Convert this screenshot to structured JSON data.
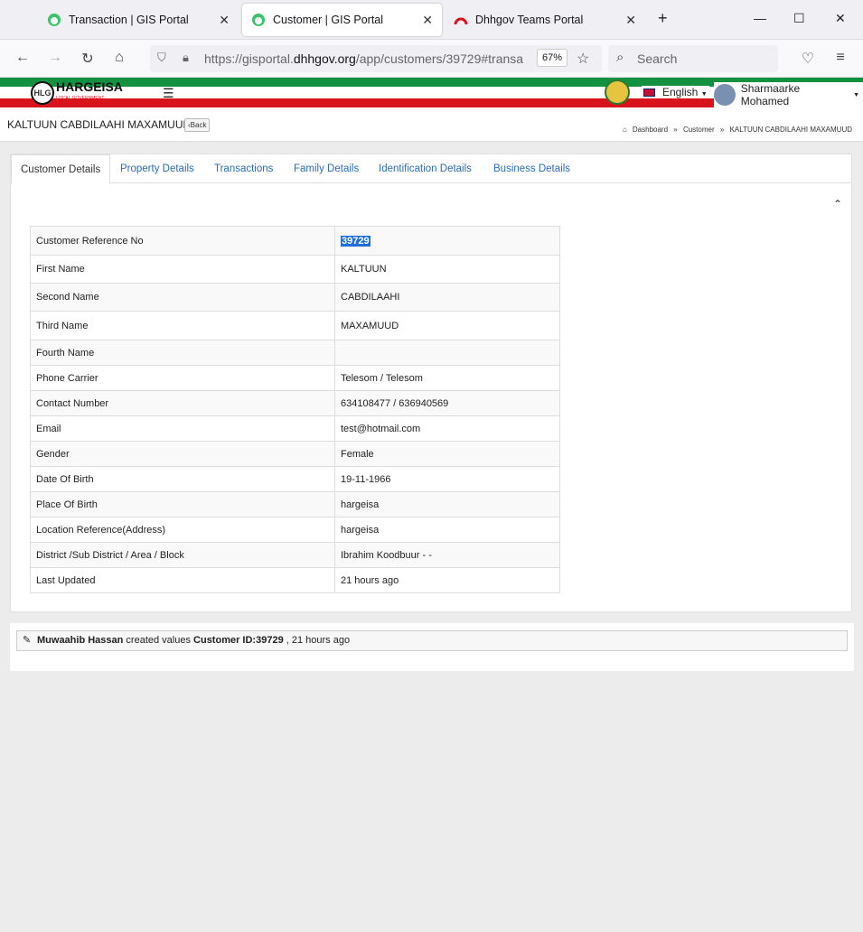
{
  "browser": {
    "tabs": [
      {
        "title": "Transaction | GIS Portal",
        "active": false
      },
      {
        "title": "Customer | GIS Portal",
        "active": true
      },
      {
        "title": "Dhhgov Teams Portal",
        "active": false
      }
    ],
    "url_prefix": "https://gisportal.",
    "url_domain": "dhhgov.org",
    "url_path": "/app/customers/39729#transa",
    "zoom": "67%",
    "search_placeholder": "Search"
  },
  "header": {
    "brand": "HARGEISA",
    "brand_sub": "LOCAL GOVERNMENT",
    "logo_text": "HLG",
    "language": "English",
    "user": "Sharmaarke Mohamed"
  },
  "page": {
    "title": "KALTUUN CABDILAAHI MAXAMUUD",
    "back": "Back",
    "breadcrumb": [
      "Dashboard",
      "Customer",
      "KALTUUN CABDILAAHI MAXAMUUD"
    ]
  },
  "tabs": [
    "Customer Details",
    "Property Details",
    "Transactions",
    "Family Details",
    "Identification Details",
    "Business Details"
  ],
  "details": [
    {
      "label": "Customer Reference No",
      "value": "39729",
      "h": 32
    },
    {
      "label": "First Name",
      "value": "KALTUUN",
      "h": 31
    },
    {
      "label": "Second Name",
      "value": "CABDILAAHI",
      "h": 31
    },
    {
      "label": "Third Name",
      "value": "MAXAMUUD",
      "h": 32
    },
    {
      "label": "Fourth Name",
      "value": "",
      "h": 28
    },
    {
      "label": "Phone Carrier",
      "value": "Telesom / Telesom",
      "h": 28
    },
    {
      "label": "Contact Number",
      "value": "634108477 / 636940569",
      "h": 28
    },
    {
      "label": "Email",
      "value": "test@hotmail.com",
      "h": 28
    },
    {
      "label": "Gender",
      "value": "Female",
      "h": 28
    },
    {
      "label": "Date Of Birth",
      "value": "19-11-1966",
      "h": 28
    },
    {
      "label": "Place Of Birth",
      "value": "hargeisa",
      "h": 28
    },
    {
      "label": "Location Reference(Address)",
      "value": "hargeisa",
      "h": 28
    },
    {
      "label": "District /Sub District / Area / Block",
      "value": "Ibrahim Koodbuur - -",
      "h": 28
    },
    {
      "label": "Last Updated",
      "value": "21 hours ago",
      "h": 28
    }
  ],
  "activity": {
    "user": "Muwaahib Hassan",
    "action": "created values",
    "target": "Customer ID:39729",
    "time": ", 21 hours ago"
  },
  "colors": {
    "green": "#139140",
    "red": "#d9131c",
    "link": "#2a6db0",
    "selection": "#1e6fd8"
  }
}
